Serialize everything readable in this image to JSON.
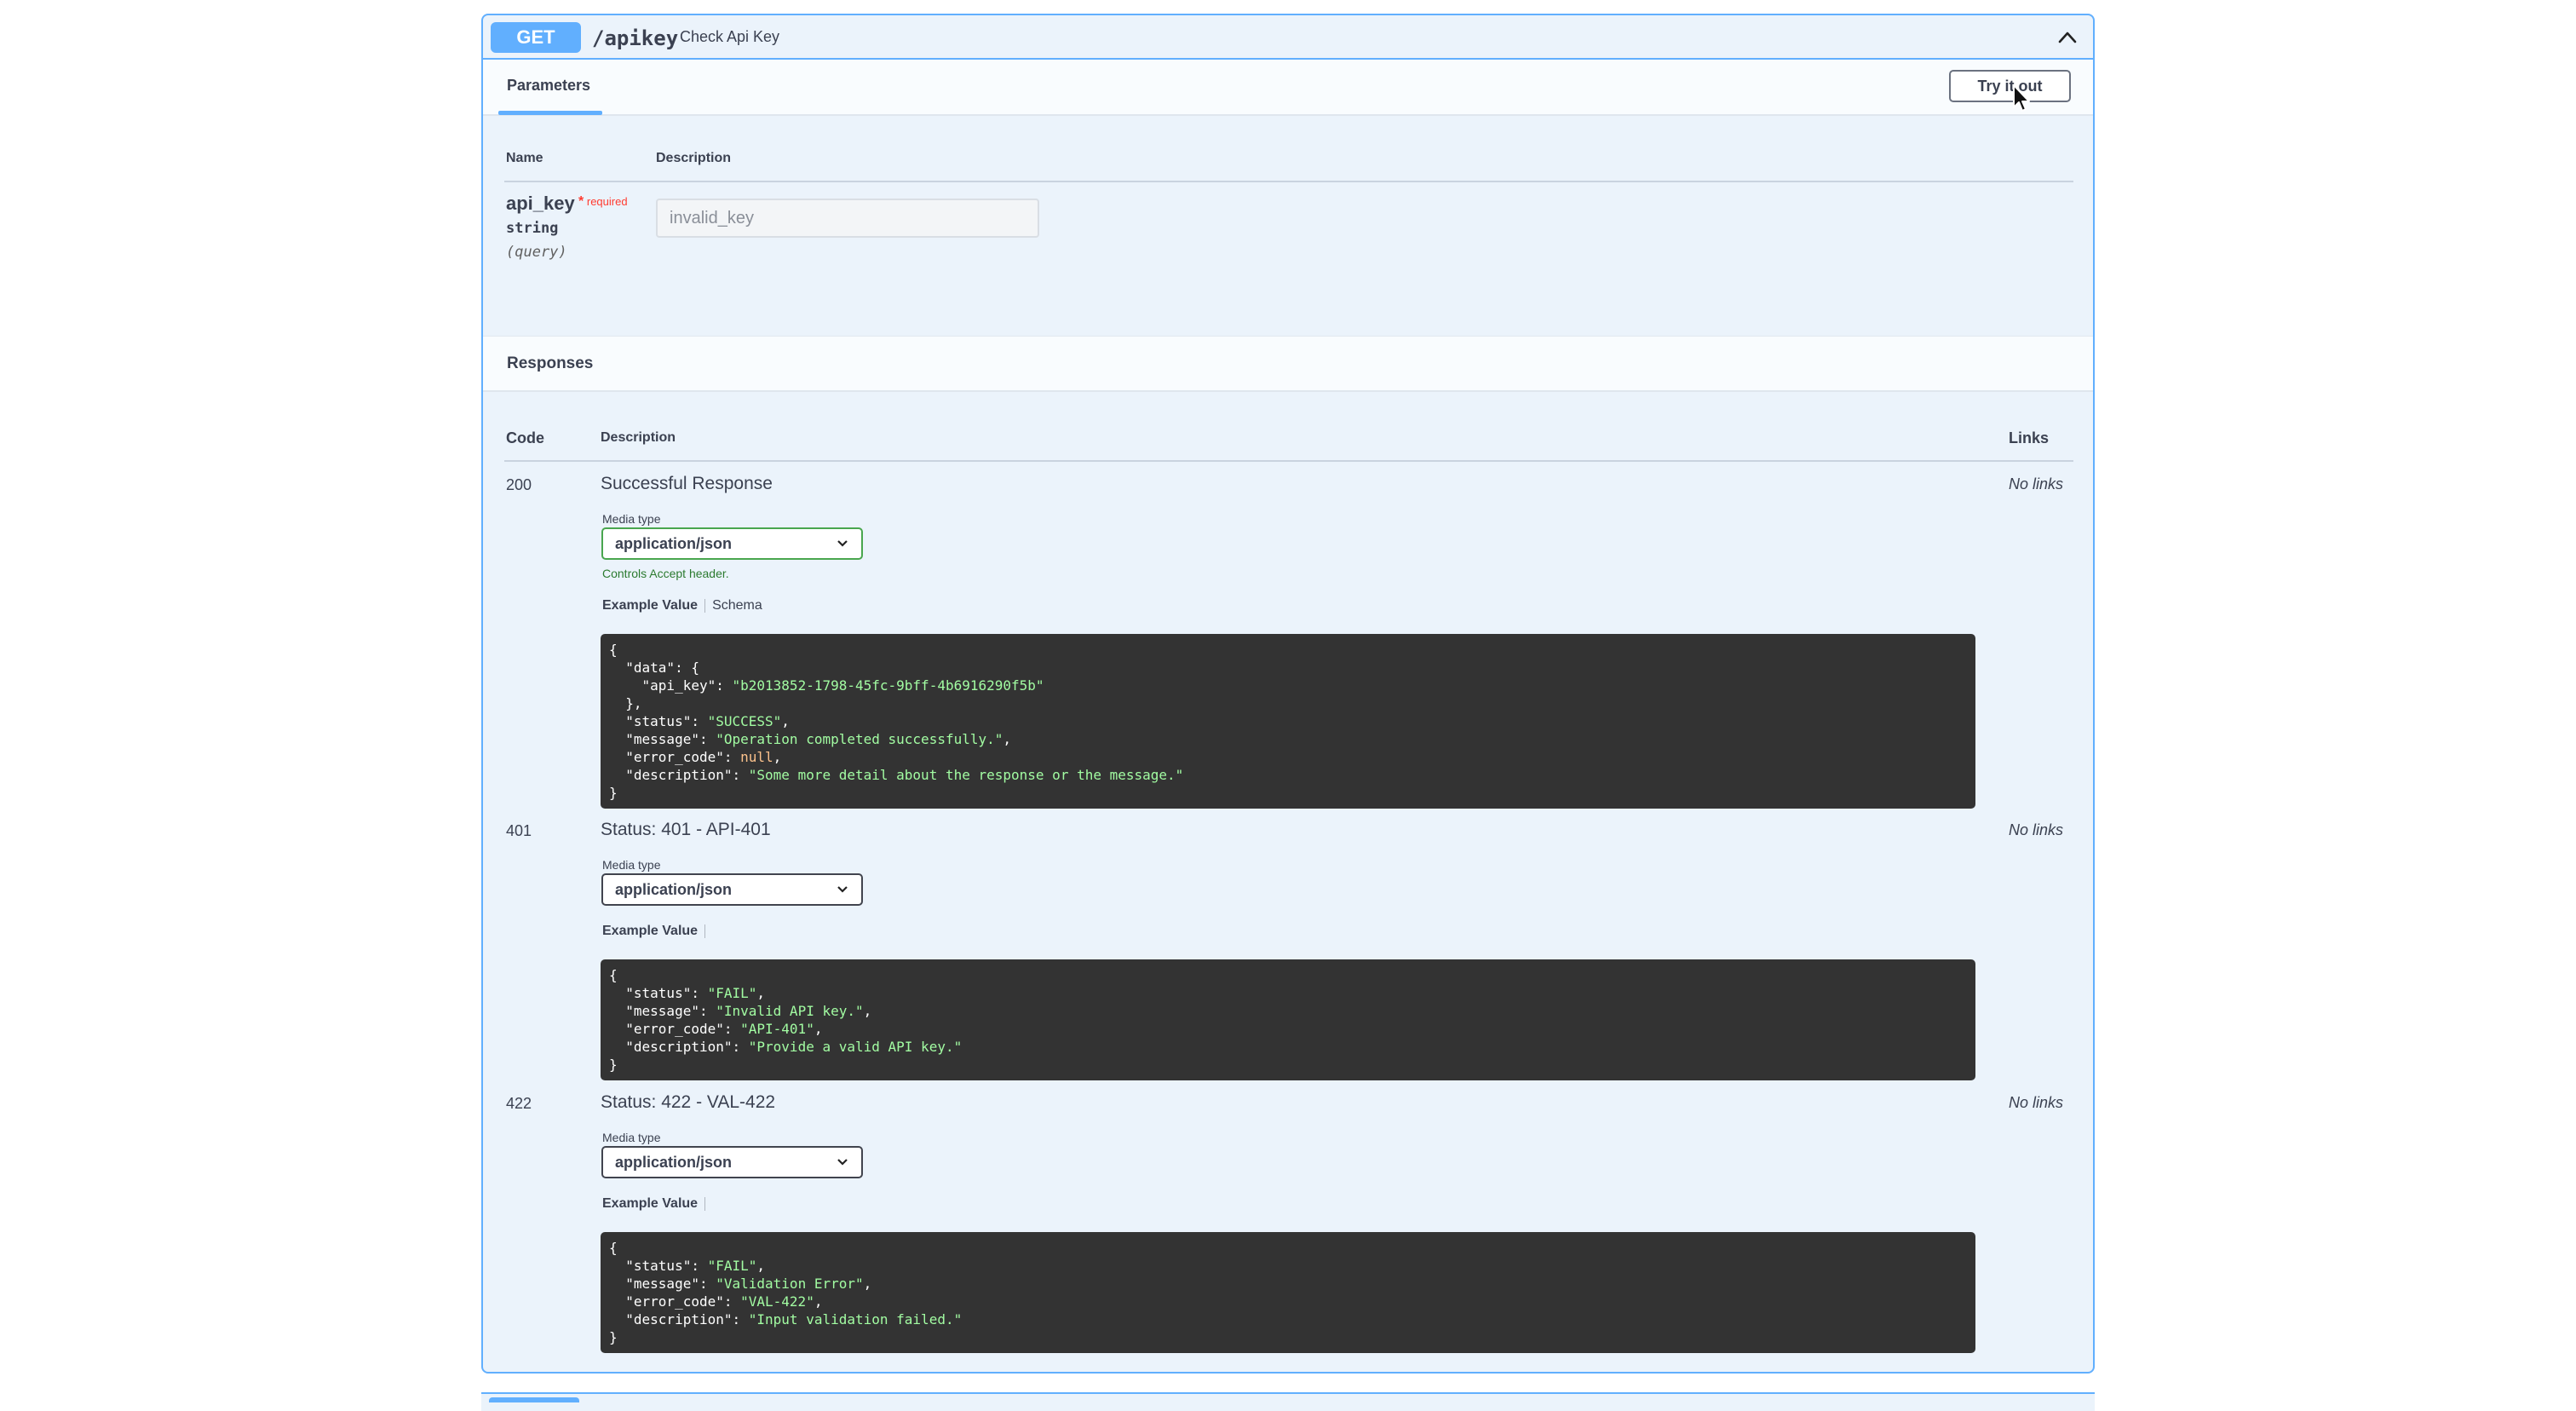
{
  "operation": {
    "method": "GET",
    "path": "/apikey",
    "summary": "Check Api Key",
    "collapse_icon": "chevron-up-icon"
  },
  "parameters": {
    "tab_label": "Parameters",
    "try_button": "Try it out",
    "col_name": "Name",
    "col_description": "Description",
    "param": {
      "name": "api_key",
      "required_star": "*",
      "required_label": "required",
      "type": "string",
      "in": "(query)",
      "value": "invalid_key"
    }
  },
  "responses": {
    "title": "Responses",
    "col_code": "Code",
    "col_description": "Description",
    "col_links": "Links",
    "items": [
      {
        "code": "200",
        "description": "Successful Response",
        "links": "No links",
        "media_label": "Media type",
        "media_value": "application/json",
        "controls_note": "Controls Accept header.",
        "tab_example": "Example Value",
        "tab_schema": "Schema",
        "example": "{\n  \"data\": {\n    \"api_key\": \"b2013852-1798-45fc-9bff-4b6916290f5b\"\n  },\n  \"status\": \"SUCCESS\",\n  \"message\": \"Operation completed successfully.\",\n  \"error_code\": null,\n  \"description\": \"Some more detail about the response or the message.\"\n}"
      },
      {
        "code": "401",
        "description": "Status: 401 - API-401",
        "links": "No links",
        "media_label": "Media type",
        "media_value": "application/json",
        "tab_example": "Example Value",
        "example": "{\n  \"status\": \"FAIL\",\n  \"message\": \"Invalid API key.\",\n  \"error_code\": \"API-401\",\n  \"description\": \"Provide a valid API key.\"\n}"
      },
      {
        "code": "422",
        "description": "Status: 422 - VAL-422",
        "links": "No links",
        "media_label": "Media type",
        "media_value": "application/json",
        "tab_example": "Example Value",
        "example": "{\n  \"status\": \"FAIL\",\n  \"message\": \"Validation Error\",\n  \"error_code\": \"VAL-422\",\n  \"description\": \"Input validation failed.\"\n}"
      }
    ]
  },
  "colors": {
    "get_blue": "#61affe",
    "panel_bg": "#ebf3fb",
    "code_bg": "#333333",
    "string_green": "#a2fca2",
    "required_red": "#ff3b30"
  }
}
